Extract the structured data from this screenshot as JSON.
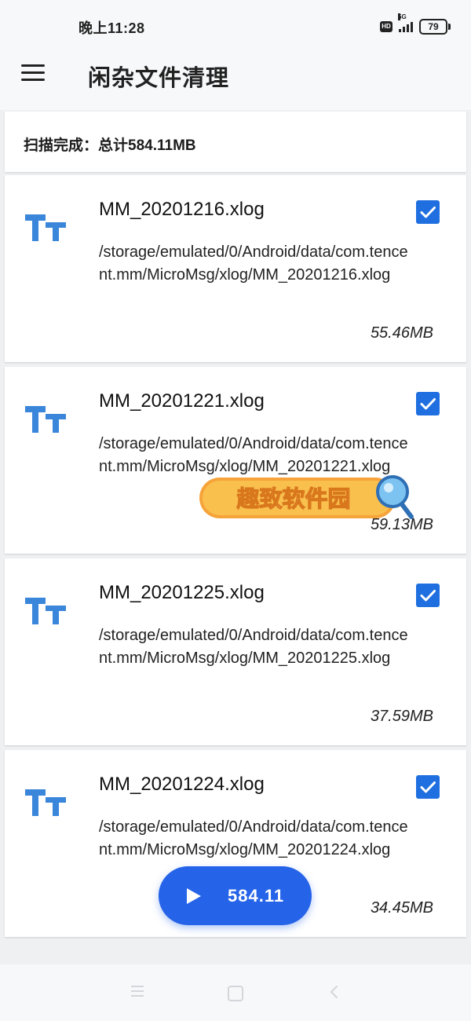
{
  "status_bar": {
    "time": "晚上11:28",
    "network_label": "5G",
    "hd_label": "HD",
    "battery": "79"
  },
  "app_bar": {
    "title": "闲杂文件清理",
    "menu_icon": "menu-icon"
  },
  "summary": {
    "text": "扫描完成：总计584.11MB"
  },
  "files": [
    {
      "name": "MM_20201216.xlog",
      "path": "/storage/emulated/0/Android/data/com.tencent.mm/MicroMsg/xlog/MM_20201216.xlog",
      "size": "55.46MB",
      "checked": true
    },
    {
      "name": "MM_20201221.xlog",
      "path": "/storage/emulated/0/Android/data/com.tencent.mm/MicroMsg/xlog/MM_20201221.xlog",
      "size": "59.13MB",
      "checked": true
    },
    {
      "name": "MM_20201225.xlog",
      "path": "/storage/emulated/0/Android/data/com.tencent.mm/MicroMsg/xlog/MM_20201225.xlog",
      "size": "37.59MB",
      "checked": true
    },
    {
      "name": "MM_20201224.xlog",
      "path": "/storage/emulated/0/Android/data/com.tencent.mm/MicroMsg/xlog/MM_20201224.xlog",
      "size": "34.45MB",
      "checked": true
    }
  ],
  "fab": {
    "value": "584.11",
    "icon": "play-icon"
  },
  "watermark": {
    "text": "趣致软件园"
  },
  "colors": {
    "accent": "#2563e8",
    "checkbox": "#1f6fe0",
    "file_icon": "#3a86db",
    "background": "#eef0f2",
    "card": "#ffffff"
  }
}
